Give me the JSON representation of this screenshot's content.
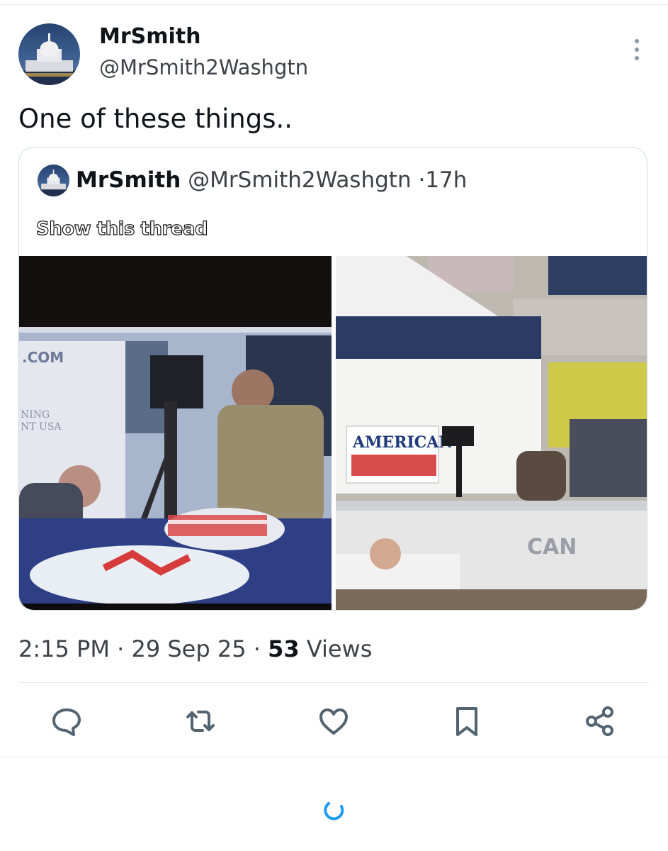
{
  "tweet": {
    "author_name": "MrSmith",
    "author_handle": "@MrSmith2Washgtn",
    "text": "One of these things..",
    "time": "2:15 PM",
    "separator": "·",
    "date": "29 Sep 25",
    "views_count": "53",
    "views_label": "Views"
  },
  "quote": {
    "author_name": "MrSmith",
    "author_handle": "@MrSmith2Washgtn",
    "separator": "·",
    "age": "17h",
    "show_thread": "Show this thread",
    "media_left_text": [
      ".COM",
      "NING",
      "NT USA"
    ],
    "media_right_text": [
      "AMERICAN",
      "CAN"
    ]
  },
  "actions": {
    "icons": [
      "reply-icon",
      "retweet-icon",
      "like-icon",
      "bookmark-icon",
      "share-icon"
    ]
  },
  "colors": {
    "accent": "#1d9bf0",
    "icon": "#536471",
    "text_primary": "#0f1419",
    "text_secondary": "#3c4247",
    "border": "#cfd9de"
  }
}
